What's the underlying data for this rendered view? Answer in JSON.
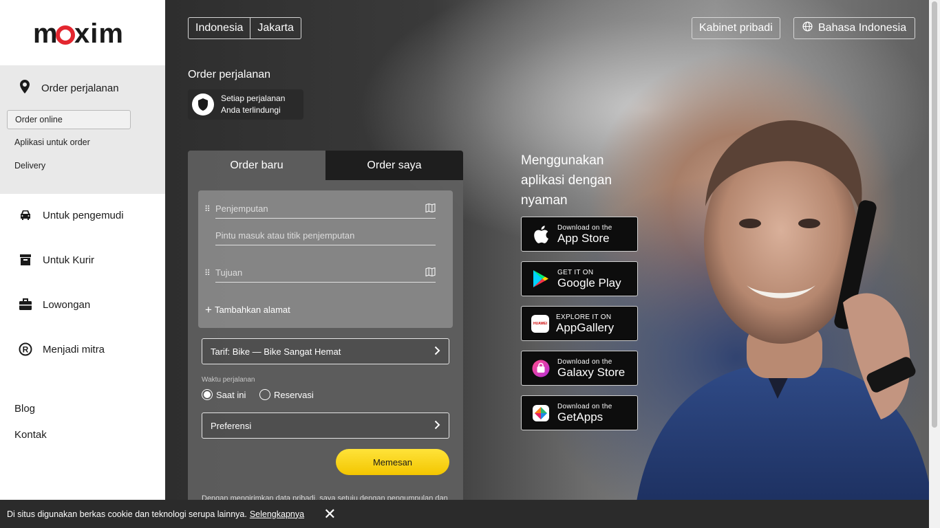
{
  "brand": {
    "logo_text": "maxim",
    "accent": "#e3262f"
  },
  "sidebar": {
    "order_section": {
      "title": "Order perjalanan",
      "items": [
        {
          "label": "Order online",
          "active": true
        },
        {
          "label": "Aplikasi untuk order"
        },
        {
          "label": "Delivery"
        }
      ]
    },
    "items": [
      {
        "label": "Untuk pengemudi",
        "icon": "car-icon"
      },
      {
        "label": "Untuk Kurir",
        "icon": "box-icon"
      },
      {
        "label": "Lowongan",
        "icon": "briefcase-icon"
      },
      {
        "label": "Menjadi mitra",
        "icon": "registered-icon"
      }
    ],
    "links": [
      {
        "label": "Blog"
      },
      {
        "label": "Kontak"
      }
    ]
  },
  "header": {
    "country": "Indonesia",
    "city": "Jakarta",
    "cabinet": "Kabinet pribadi",
    "language": "Bahasa Indonesia"
  },
  "order": {
    "title": "Order perjalanan",
    "protection": {
      "line1": "Setiap perjalanan",
      "line2": "Anda terlindungi"
    },
    "tabs": [
      {
        "label": "Order baru",
        "active": true
      },
      {
        "label": "Order saya"
      }
    ],
    "pickup_placeholder": "Penjemputan",
    "entrance_placeholder": "Pintu masuk atau titik penjemputan",
    "destination_placeholder": "Tujuan",
    "add_address": "Tambahkan alamat",
    "tariff": "Tarif: Bike — Bike Sangat Hemat",
    "time_label": "Waktu perjalanan",
    "time_options": [
      {
        "label": "Saat ini",
        "selected": true
      },
      {
        "label": "Reservasi",
        "selected": false
      }
    ],
    "preferences": "Preferensi",
    "submit": "Memesan",
    "submit_color": "#fbd612",
    "disclaimer": "Dengan mengirimkan data pribadi, saya setuju dengan pengumpulan dan"
  },
  "apps": {
    "title": "Menggunakan aplikasi dengan nyaman",
    "badges": [
      {
        "small": "Download on the",
        "big": "App Store",
        "icon": "apple-icon"
      },
      {
        "small": "GET IT ON",
        "big": "Google Play",
        "icon": "google-play-icon"
      },
      {
        "small": "EXPLORE IT ON",
        "big": "AppGallery",
        "icon": "huawei-icon",
        "icon_text": "HUAWEI"
      },
      {
        "small": "Download on the",
        "big": "Galaxy Store",
        "icon": "galaxy-store-icon"
      },
      {
        "small": "Download on the",
        "big": "GetApps",
        "icon": "getapps-icon"
      }
    ]
  },
  "cookie": {
    "text": "Di situs digunakan berkas cookie dan teknologi serupa lainnya.",
    "link": "Selengkapnya"
  }
}
